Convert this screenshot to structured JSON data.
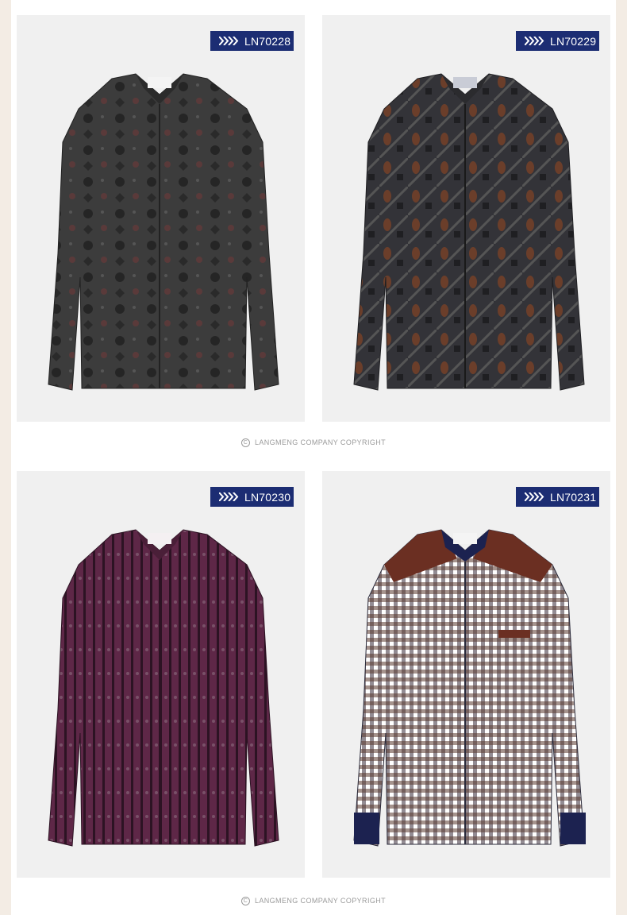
{
  "products": [
    {
      "code": "LN70228",
      "shirt_color": "#3a3a3a",
      "pattern": "floral-dark"
    },
    {
      "code": "LN70229",
      "shirt_color": "#2f2f33",
      "pattern": "abstract-brown"
    },
    {
      "code": "LN70230",
      "shirt_color": "#5a2444",
      "pattern": "purple-stripe"
    },
    {
      "code": "LN70231",
      "shirt_color": "#ffffff",
      "pattern": "gingham-navy-brown"
    }
  ],
  "copyright": {
    "symbol": "C",
    "text": "LANGMENG COMPANY COPYRIGHT"
  },
  "colors": {
    "badge": "#1c2d73",
    "background": "#f3ece4"
  }
}
